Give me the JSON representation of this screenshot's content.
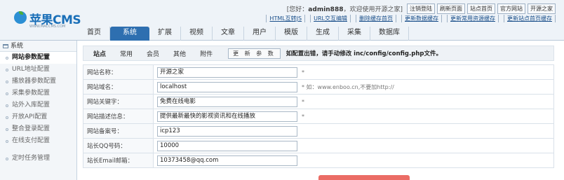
{
  "brand": {
    "logo_text": "苹果CMS",
    "logo_sub": "WWW.MACCMS.COM"
  },
  "top": {
    "user_prefix": "[您好：",
    "user_name": "admin888",
    "user_suffix": "，欢迎使用开源之家]",
    "buttons": [
      "注销登陆",
      "刷新页面",
      "站点首页",
      "官方网站",
      "开源之家"
    ]
  },
  "quick_links": [
    "HTML互转JS",
    "URL交互编辑",
    "删除缓存首页",
    "更新数据缓存",
    "更新常用资源缓存",
    "更新站点首页缓存"
  ],
  "nav": [
    "首页",
    "系统",
    "扩展",
    "视频",
    "文章",
    "用户",
    "模版",
    "生成",
    "采集",
    "数据库"
  ],
  "nav_active": 1,
  "sidebar": {
    "title": "系统",
    "items": [
      "网站参数配置",
      "URL地址配置",
      "播放器参数配置",
      "采集参数配置",
      "站外入库配置",
      "开放API配置",
      "整合登录配置",
      "在线支付配置"
    ],
    "extra": "定时任务管理"
  },
  "subtabs": [
    "站点",
    "常用",
    "会员",
    "其他",
    "附件"
  ],
  "update_button": "更 新 参 数",
  "hint": "如配置出错，请手动修改 inc/config/config.php文件。",
  "form": [
    {
      "label": "网站名称：",
      "value": "开源之家",
      "note": "*"
    },
    {
      "label": "网站域名：",
      "value": "localhost",
      "note": "* 如：www.enboo.cn,不要加http://"
    },
    {
      "label": "网站关键字：",
      "value": "免费在线电影",
      "note": "*"
    },
    {
      "label": "网站描述信息：",
      "value": "提供最新最快的影视资讯和在线播放",
      "note": "*"
    },
    {
      "label": "网站备案号：",
      "value": "icp123",
      "note": ""
    },
    {
      "label": "站长QQ号码：",
      "value": "10000",
      "note": ""
    },
    {
      "label": "站长Email邮箱：",
      "value": "10373458@qq.com",
      "note": ""
    }
  ],
  "colors": {
    "accent": "#2e6fb0",
    "header_bg": "#eef3f8",
    "watermark": "#e8524a"
  }
}
